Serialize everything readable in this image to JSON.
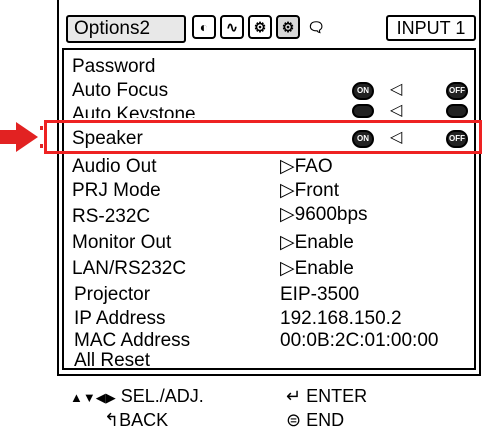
{
  "menu_title": "Options2",
  "input_label": "INPUT 1",
  "tabs": [
    {
      "icon": "picture-tab-icon",
      "glyph": "◐"
    },
    {
      "icon": "signal-tab-icon",
      "glyph": "∿"
    },
    {
      "icon": "options1-tab-icon",
      "glyph": "⚙"
    },
    {
      "icon": "options2-tab-icon",
      "glyph": "⚙"
    },
    {
      "icon": "language-tab-icon",
      "glyph": "💬"
    }
  ],
  "items": {
    "password": "Password",
    "auto_focus": "Auto Focus",
    "auto_keystone": "Auto Keystone",
    "speaker": "Speaker",
    "audio_out": "Audio Out",
    "prj_mode": "PRJ Mode",
    "rs232c": "RS-232C",
    "monitor_out": "Monitor Out",
    "lan_rs232c": "LAN/RS232C",
    "projector": "Projector",
    "ip_address": "IP Address",
    "mac_address": "MAC Address",
    "all_reset": "All Reset"
  },
  "values": {
    "audio_out": "FAO",
    "prj_mode": "Front",
    "rs232c": "9600bps",
    "monitor_out": "Enable",
    "lan_rs232c": "Enable",
    "projector": "EIP-3500",
    "ip_address": "192.168.150.2",
    "mac_address": "00:0B:2C:01:00:00"
  },
  "toggles": {
    "on": "ON",
    "off": "OFF"
  },
  "footer": {
    "sel_adj": "SEL./ADJ.",
    "enter": "ENTER",
    "back": "BACK",
    "end": "END"
  },
  "colors": {
    "highlight": "#e22222",
    "border": "#000000"
  }
}
